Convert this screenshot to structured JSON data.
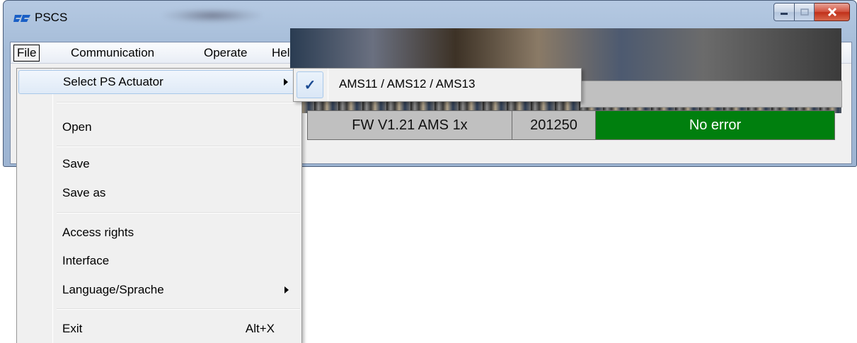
{
  "window": {
    "title": "PSCS",
    "controls": {
      "minimize": "minimize-icon",
      "maximize": "maximize-icon",
      "close": "close-icon"
    }
  },
  "menubar": {
    "items": [
      {
        "label": "File"
      },
      {
        "label": "Communication"
      },
      {
        "label": "Operate"
      },
      {
        "label": "Help"
      }
    ]
  },
  "file_menu": {
    "items": [
      {
        "label": "Select PS Actuator",
        "submenu": true
      },
      {
        "label": "Open"
      },
      {
        "label": "Save"
      },
      {
        "label": "Save as"
      },
      {
        "label": "Access rights"
      },
      {
        "label": "Interface"
      },
      {
        "label": "Language/Sprache",
        "submenu": true
      },
      {
        "label": "Exit",
        "shortcut": "Alt+X"
      }
    ]
  },
  "submenu": {
    "items": [
      {
        "label": "AMS11 / AMS12 / AMS13",
        "checked": true,
        "check_glyph": "✓"
      }
    ]
  },
  "status": {
    "firmware": "FW  V1.21 AMS 1x",
    "number": "201250",
    "error": "No error"
  },
  "colors": {
    "status_ok": "#007f0e",
    "menu_hover_border": "#a8c8ea",
    "check_color": "#1c4b93"
  }
}
